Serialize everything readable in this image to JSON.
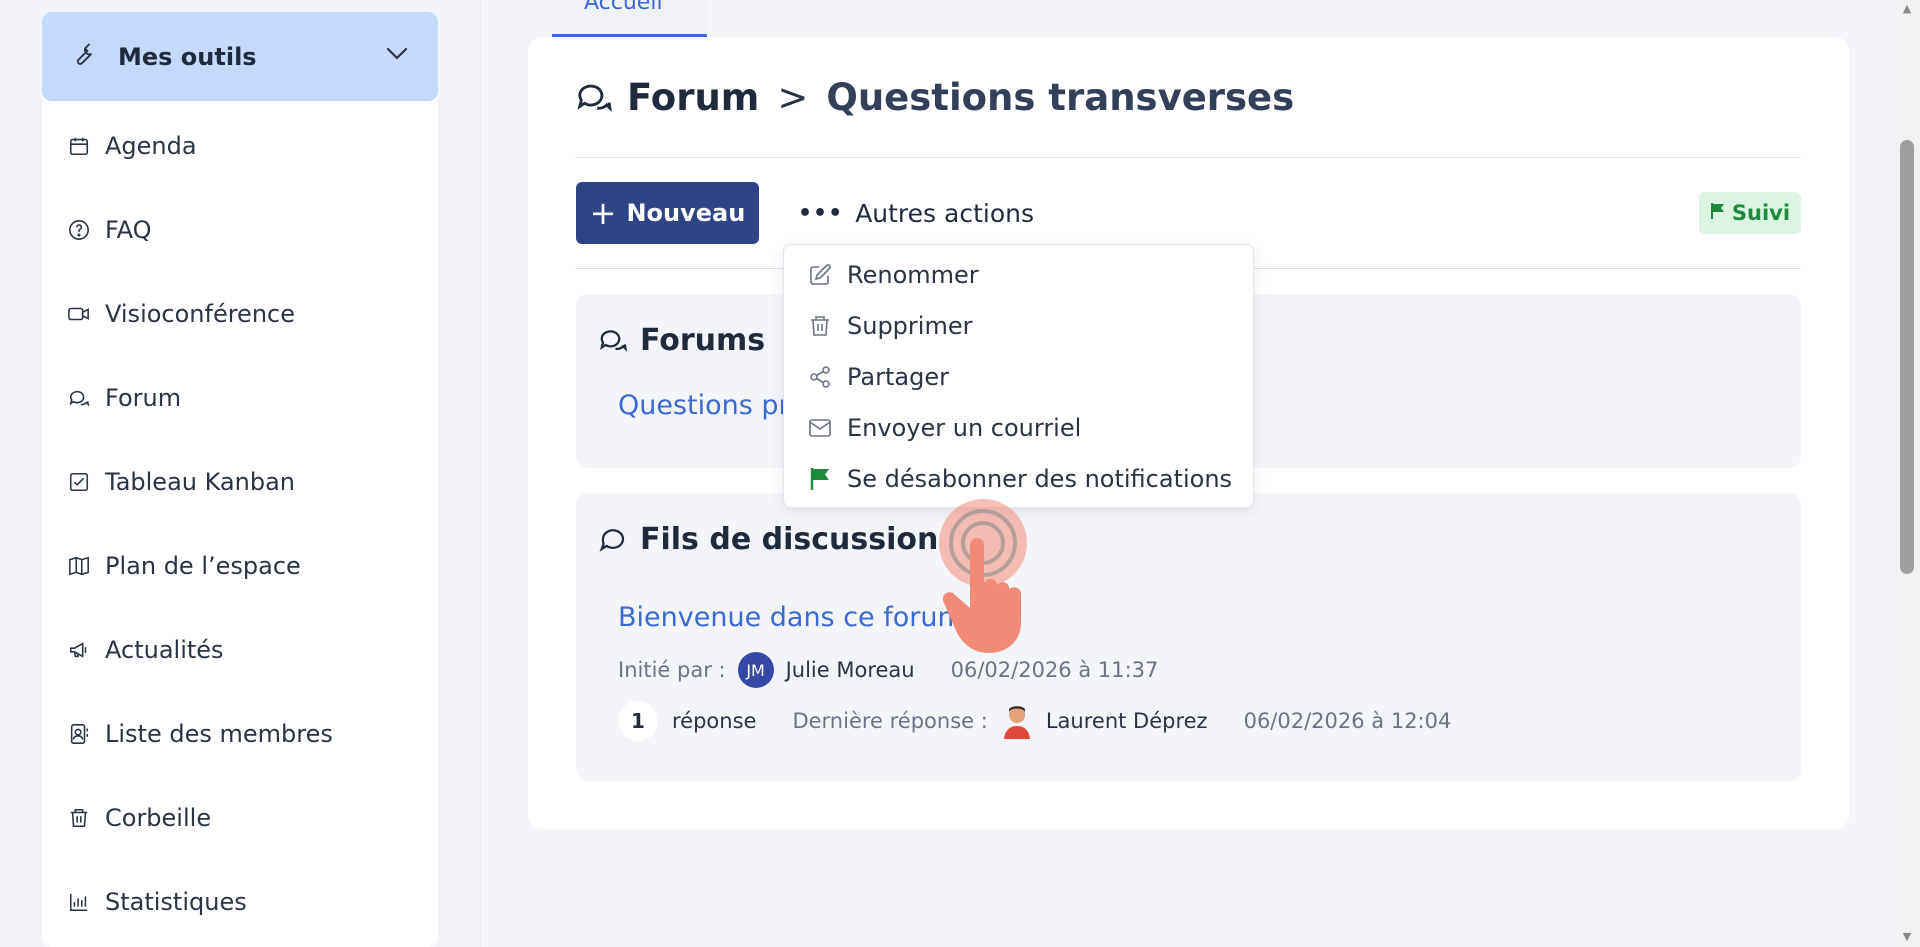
{
  "sidebar": {
    "tools_label": "Mes outils",
    "items": [
      {
        "label": "Agenda",
        "icon": "calendar-icon"
      },
      {
        "label": "FAQ",
        "icon": "help-circle-icon"
      },
      {
        "label": "Visioconférence",
        "icon": "video-icon"
      },
      {
        "label": "Forum",
        "icon": "chat-bubbles-icon"
      },
      {
        "label": "Tableau Kanban",
        "icon": "check-square-icon"
      },
      {
        "label": "Plan de l’espace",
        "icon": "map-icon"
      },
      {
        "label": "Actualités",
        "icon": "megaphone-icon"
      },
      {
        "label": "Liste des membres",
        "icon": "contacts-icon"
      },
      {
        "label": "Corbeille",
        "icon": "trash-icon"
      },
      {
        "label": "Statistiques",
        "icon": "bar-chart-icon"
      }
    ]
  },
  "tab": {
    "label": "Accueil"
  },
  "breadcrumb": {
    "root": "Forum",
    "separator": ">",
    "current": "Questions transverses"
  },
  "toolbar": {
    "new_label": "Nouveau",
    "actions_label": "Autres actions",
    "suivi_label": "Suivi"
  },
  "dropdown": {
    "items": [
      {
        "label": "Renommer",
        "icon": "edit-icon"
      },
      {
        "label": "Supprimer",
        "icon": "trash-icon"
      },
      {
        "label": "Partager",
        "icon": "share-icon"
      },
      {
        "label": "Envoyer un courriel",
        "icon": "mail-icon"
      },
      {
        "label": "Se désabonner des notifications",
        "icon": "flag-icon"
      }
    ]
  },
  "forums_section": {
    "title": "Forums",
    "link": "Questions pr"
  },
  "threads_section": {
    "title": "Fils de discussion",
    "thread": {
      "title": "Bienvenue dans ce forum",
      "started_by_label": "Initié par :",
      "author_initials": "JM",
      "author": "Julie Moreau",
      "started_at": "06/02/2026 à 11:37",
      "reply_count": "1",
      "reply_label": "réponse",
      "last_reply_label": "Dernière réponse :",
      "last_reply_author": "Laurent Déprez",
      "last_reply_at": "06/02/2026 à 12:04"
    }
  },
  "colors": {
    "accent": "#3b6ad2",
    "primary_button": "#2f4485",
    "suivi_green": "#1e8a3c",
    "tools_header": "#c5d9fb"
  }
}
